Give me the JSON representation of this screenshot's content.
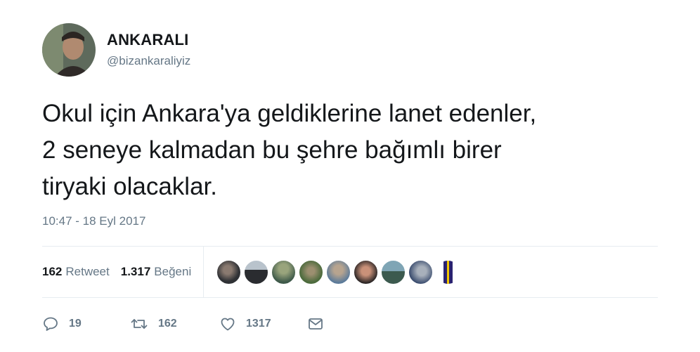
{
  "tweet": {
    "author": {
      "display_name": "ANKARALI",
      "username": "@bizankaraliyiz"
    },
    "text": "Okul için Ankara'ya geldiklerine lanet edenler,\n2 seneye kalmadan bu şehre bağımlı birer\ntiryaki olacaklar.",
    "timestamp": "10:47 - 18 Eyl 2017",
    "stats": {
      "retweets_count": "162",
      "retweets_label": "Retweet",
      "likes_count": "1.317",
      "likes_label": "Beğeni"
    },
    "likers": [
      {
        "icon": "liker-avatar"
      },
      {
        "icon": "liker-avatar"
      },
      {
        "icon": "liker-avatar"
      },
      {
        "icon": "liker-avatar"
      },
      {
        "icon": "liker-avatar"
      },
      {
        "icon": "liker-avatar"
      },
      {
        "icon": "liker-avatar"
      },
      {
        "icon": "liker-avatar"
      },
      {
        "icon": "liker-avatar"
      }
    ],
    "actions": {
      "reply_count": "19",
      "retweet_count": "162",
      "like_count": "1317"
    }
  },
  "colors": {
    "text": "#14171a",
    "secondary": "#657786",
    "divider": "#e6ecf0"
  }
}
